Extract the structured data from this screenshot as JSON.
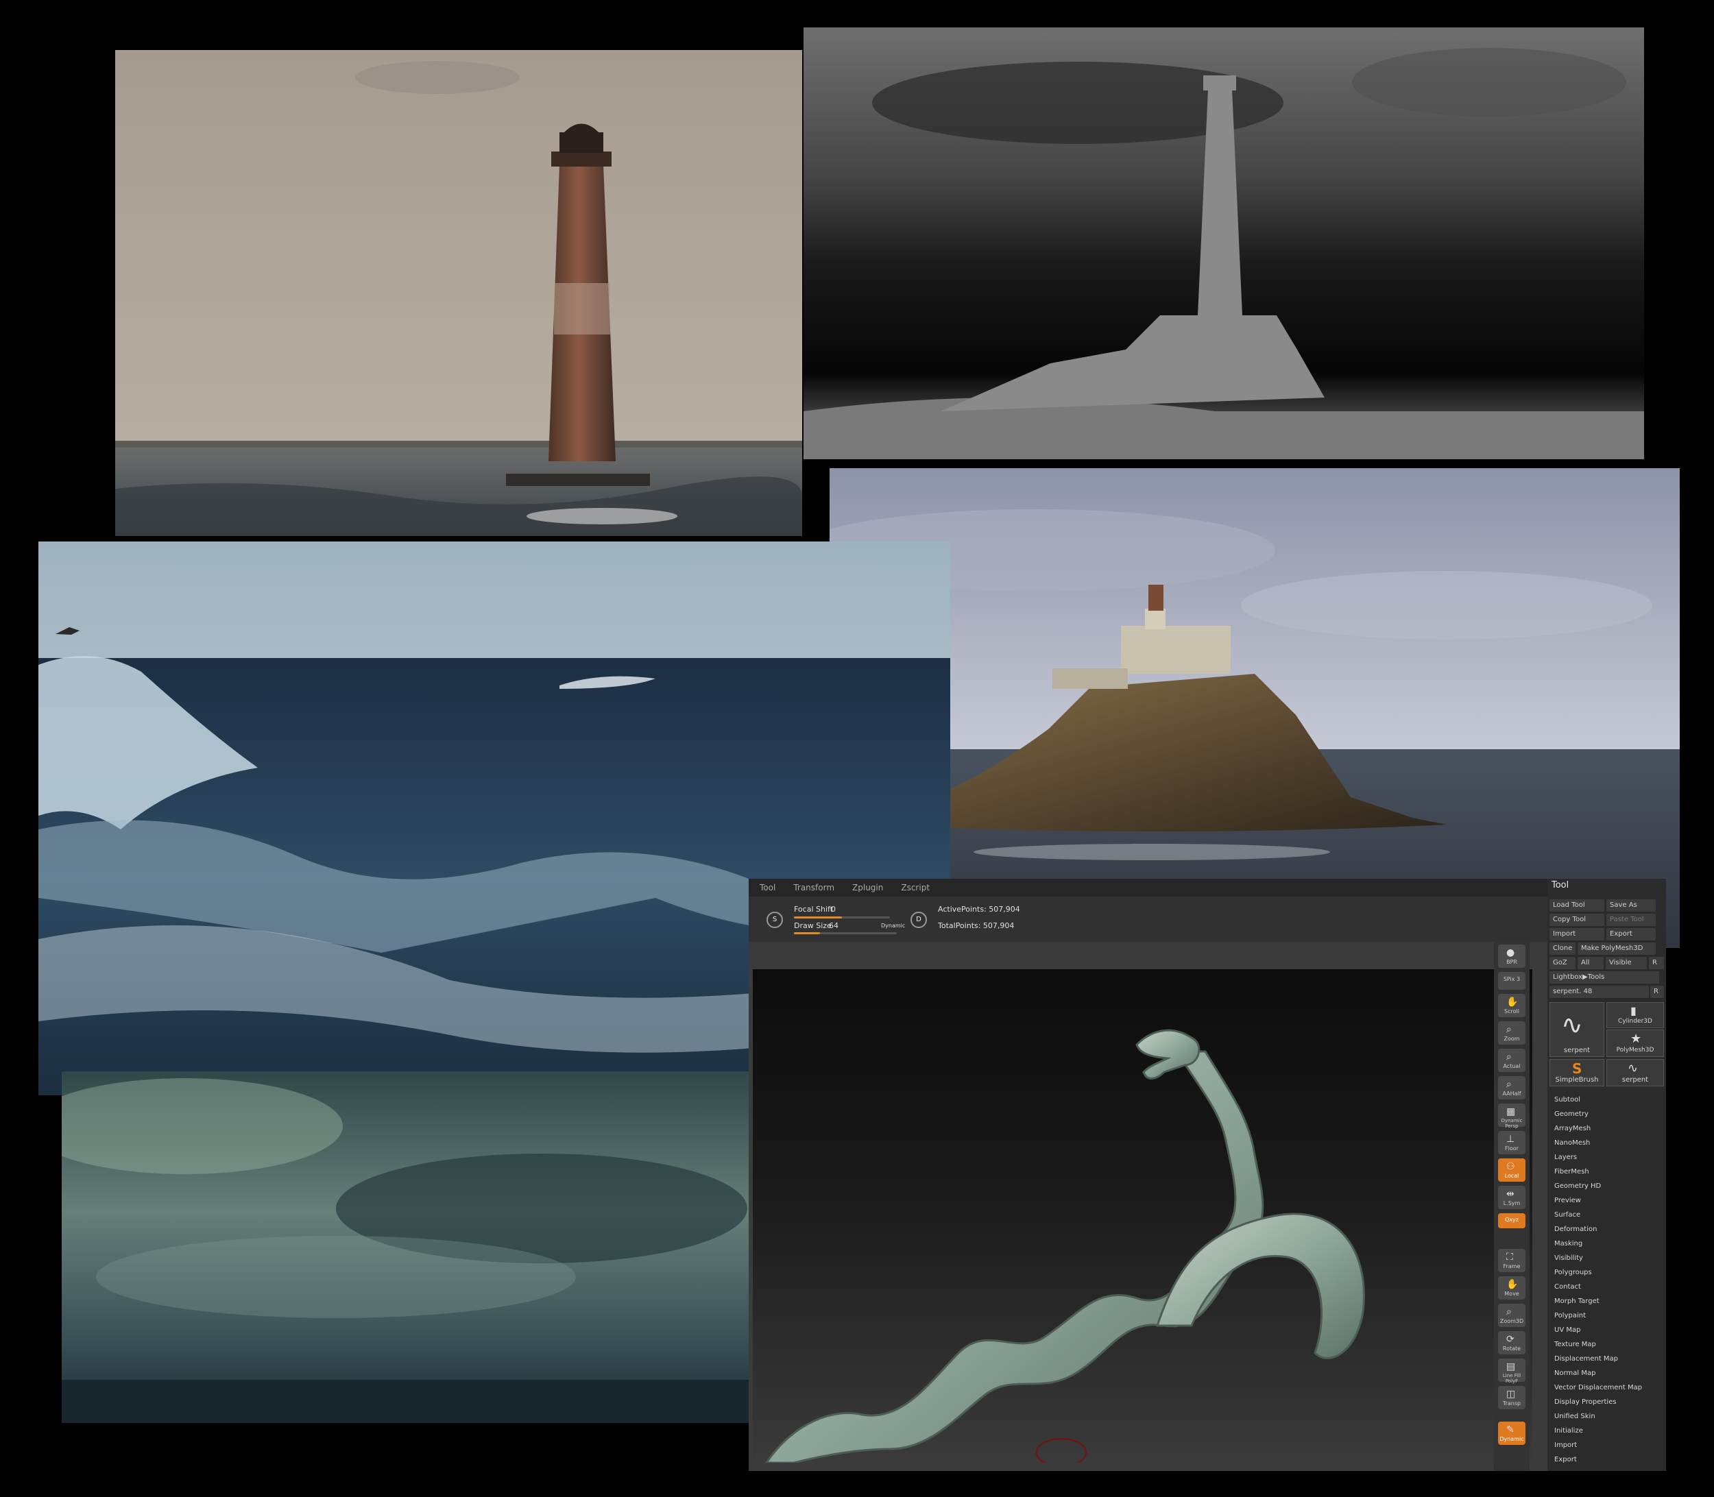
{
  "zbrush": {
    "menubar": [
      "Tool",
      "Transform",
      "Zplugin",
      "Zscript"
    ],
    "topbar": {
      "focal_shift_label": "Focal Shift",
      "focal_shift_value": "0",
      "focal_shift_level": 0.5,
      "draw_size_label": "Draw Size",
      "draw_size_value": "64",
      "draw_size_level": 0.25,
      "dynamic_label": "Dynamic",
      "s_icon": "S",
      "d_icon": "D",
      "active_points": "ActivePoints: 507,904",
      "total_points": "TotalPoints: 507,904"
    },
    "shelf": [
      {
        "label": "BPR",
        "icon": "sphere-icon"
      },
      {
        "label": "SPix 3",
        "icon": "slider-icon"
      },
      {
        "label": "Scroll",
        "icon": "hand-icon"
      },
      {
        "label": "Zoom",
        "icon": "magnifier-icon"
      },
      {
        "label": "Actual",
        "icon": "magnifier-icon"
      },
      {
        "label": "AAHalf",
        "icon": "magnifier-icon"
      },
      {
        "label": "Dynamic Persp",
        "icon": "grid-icon"
      },
      {
        "label": "Floor",
        "icon": "floor-icon"
      },
      {
        "label": "Local",
        "icon": "local-icon"
      },
      {
        "label": "L.Sym",
        "icon": "symmetry-icon"
      },
      {
        "label": "Qxyz",
        "icon": "axis-icon"
      },
      {
        "label": "Frame",
        "icon": "frame-icon"
      },
      {
        "label": "Move",
        "icon": "hand-icon"
      },
      {
        "label": "Zoom3D",
        "icon": "magnifier-icon"
      },
      {
        "label": "Rotate",
        "icon": "rotate-icon"
      },
      {
        "label": "Line Fill PolyF",
        "icon": "polyframe-icon"
      },
      {
        "label": "Transp",
        "icon": "transp-icon"
      },
      {
        "label": "Dynamic",
        "icon": "brush-icon"
      }
    ],
    "tool": {
      "title": "Tool",
      "buttons": {
        "load_tool": "Load Tool",
        "save_as": "Save As",
        "copy_tool": "Copy Tool",
        "paste_tool": "Paste Tool",
        "import": "Import",
        "export": "Export",
        "clone": "Clone",
        "make_polymesh": "Make PolyMesh3D",
        "goz": "GoZ",
        "all": "All",
        "visible": "Visible",
        "r": "R",
        "lightbox": "Lightbox▶Tools",
        "current_tool": "serpent. 48",
        "r2": "R"
      },
      "thumbs": {
        "serpent_large": "serpent",
        "cylinder": "Cylinder3D",
        "polymesh": "PolyMesh3D",
        "simplebrush": "SimpleBrush",
        "serpent_small": "serpent"
      },
      "menu": [
        "Subtool",
        "Geometry",
        "ArrayMesh",
        "NanoMesh",
        "Layers",
        "FiberMesh",
        "Geometry HD",
        "Preview",
        "Surface",
        "Deformation",
        "Masking",
        "Visibility",
        "Polygroups",
        "Contact",
        "Morph Target",
        "Polypaint",
        "UV Map",
        "Texture Map",
        "Displacement Map",
        "Normal Map",
        "Vector Displacement Map",
        "Display Properties",
        "Unified Skin",
        "Initialize",
        "Import",
        "Export"
      ]
    }
  },
  "colors": {
    "accent": "#e07a20",
    "panel": "#2b2b2b",
    "background": "#000000"
  }
}
